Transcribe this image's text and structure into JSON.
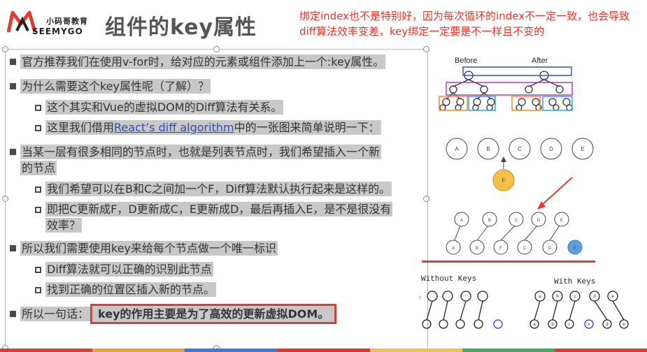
{
  "logo": {
    "cn": "小码哥教育",
    "en": "SEEMYGO"
  },
  "title": "组件的key属性",
  "note": "绑定index也不是特别好，因为每次循环的index不一定一致，也会导致diff算法效率变差，key绑定一定要是不一样且不变的",
  "lines": {
    "l1": "官方推荐我们在使用v-for时，给对应的元素或组件添加上一个:key属性。",
    "l2": "为什么需要这个key属性呢（了解）？",
    "l3": "这个其实和Vue的虚拟DOM的Diff算法有关系。",
    "l4a": "这里我们借用",
    "l4link": "React’s diff algorithm",
    "l4b": "中的一张图来简单说明一下：",
    "l5a": "当某一层有很多相同的节点时，也就是列表节点时，我们希望插入一个新",
    "l5b": "的节点",
    "l6": "我们希望可以在B和C之间加一个F，Diff算法默认执行起来是这样的。",
    "l7a": "即把C更新成F，D更新成C，E更新成D，最后再插入E，是不是很没有",
    "l7b": "效率？",
    "l8": "所以我们需要使用key来给每个节点做一个唯一标识",
    "l9": "Diff算法就可以正确的识别此节点",
    "l10": "找到正确的位置区插入新的节点。",
    "l11a": "所以一句话：",
    "l11b": "key的作用主要是为了高效的更新虚拟DOM。"
  },
  "diagram": {
    "before": "Before",
    "after": "After",
    "top_row": [
      "A",
      "B",
      "C",
      "D",
      "E"
    ],
    "new_node": "F",
    "bottom_row1": [
      "A",
      "B",
      "C",
      "D",
      "E"
    ],
    "bottom_row2": [
      "A",
      "B",
      "F",
      "C",
      "D",
      "E"
    ],
    "without_keys": "Without Keys",
    "with_keys": "With Keys",
    "key_labels": [
      "a",
      "b",
      "c",
      "d",
      "e"
    ],
    "key_inserted": "x"
  },
  "colors": {
    "accent": "#e23b30",
    "link": "#2a4fb8",
    "highlight": "#c8c8c8",
    "purple": "#b23cc8",
    "orange": "#e8912a",
    "cyan": "#2aa8d8",
    "blue_node": "#5aa0e0",
    "yellow_node": "#f5c04a"
  }
}
